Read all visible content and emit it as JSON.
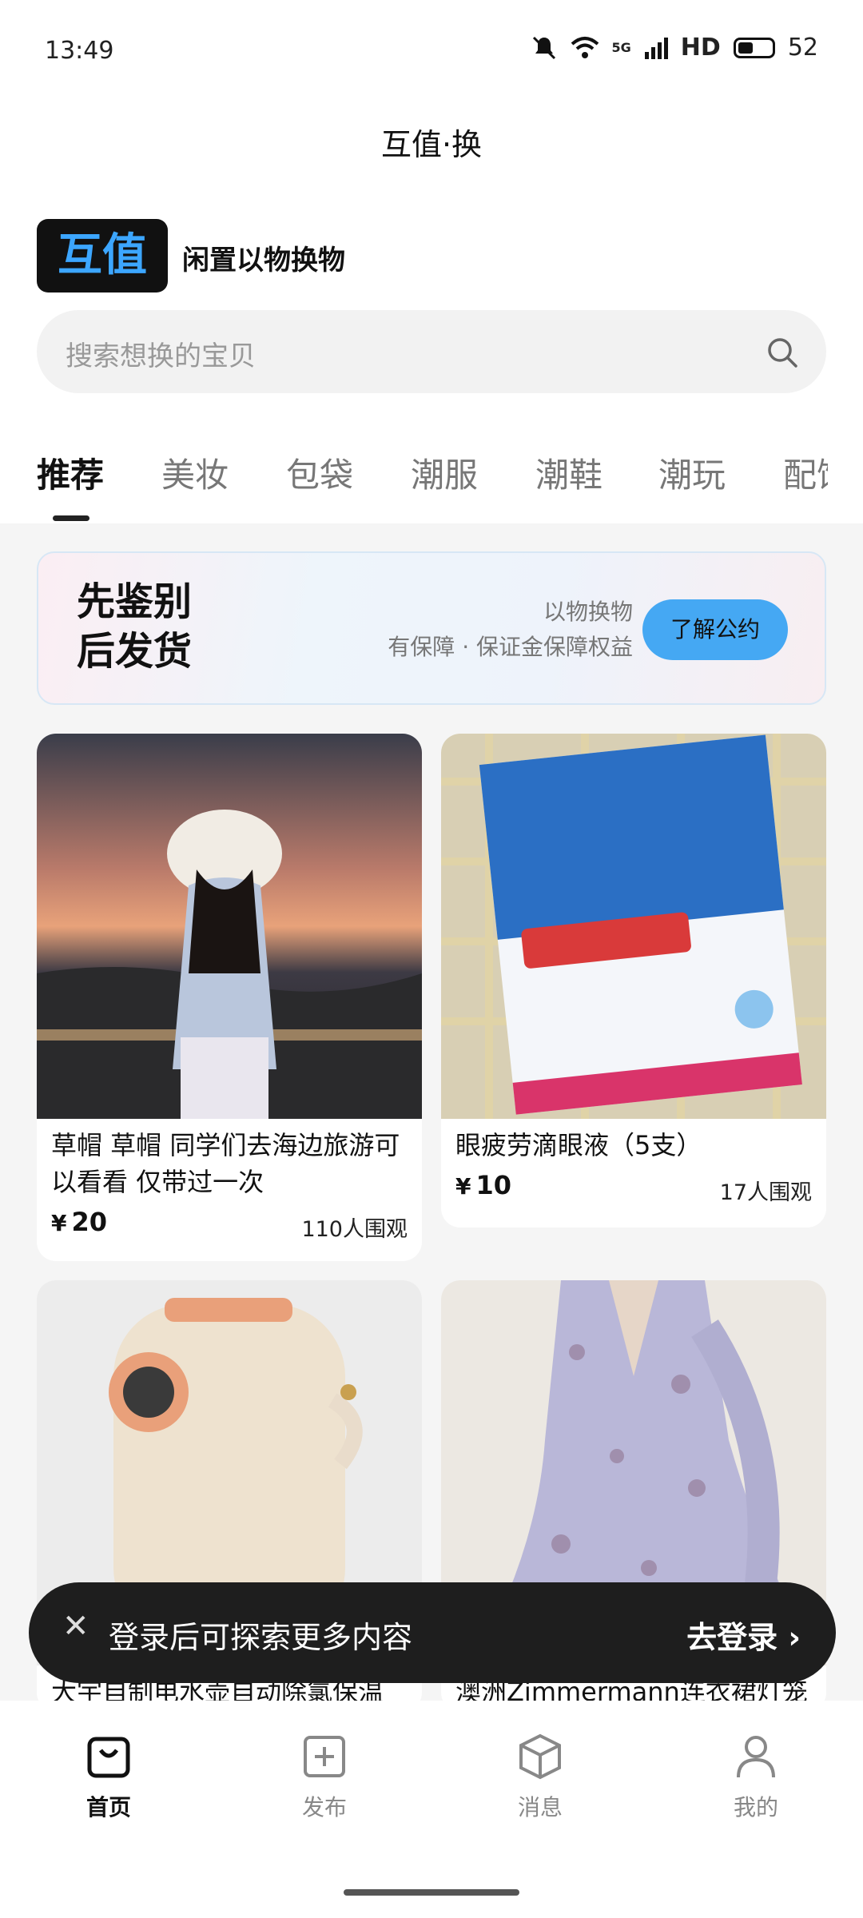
{
  "status": {
    "time": "13:49",
    "network": "5G",
    "hd": "HD",
    "battery": "52"
  },
  "app_title": "互值·换",
  "brand": {
    "logo": "互值",
    "tagline": "闲置以物换物"
  },
  "search": {
    "placeholder": "搜索想换的宝贝"
  },
  "tabs": [
    {
      "label": "推荐"
    },
    {
      "label": "美妆"
    },
    {
      "label": "包袋"
    },
    {
      "label": "潮服"
    },
    {
      "label": "潮鞋"
    },
    {
      "label": "潮玩"
    },
    {
      "label": "配饰"
    }
  ],
  "banner": {
    "line1": "先鉴别",
    "line2": "后发货",
    "sub1": "以物换物",
    "sub2": "有保障 · 保证金保障权益",
    "button": "了解公约"
  },
  "products": [
    {
      "title": "草帽 草帽 同学们去海边旅游可以看看 仅带过一次",
      "currency": "¥",
      "price": "20",
      "watchers": "110人围观"
    },
    {
      "title": "眼疲劳滴眼液（5支）",
      "currency": "¥",
      "price": "10",
      "watchers": "17人围观"
    },
    {
      "title": "大宇自制电水壶自动除氯保温一"
    },
    {
      "title": "澳洲Zimmermann连衣裙灯笼袖"
    }
  ],
  "toast": {
    "message": "登录后可探索更多内容",
    "cta": "去登录 ›"
  },
  "tabbar": [
    {
      "label": "首页"
    },
    {
      "label": "发布"
    },
    {
      "label": "消息"
    },
    {
      "label": "我的"
    }
  ],
  "colors": {
    "accent": "#45a8f3",
    "logo_text": "#3ca6ff",
    "toast_bg": "#1e1e1e"
  }
}
